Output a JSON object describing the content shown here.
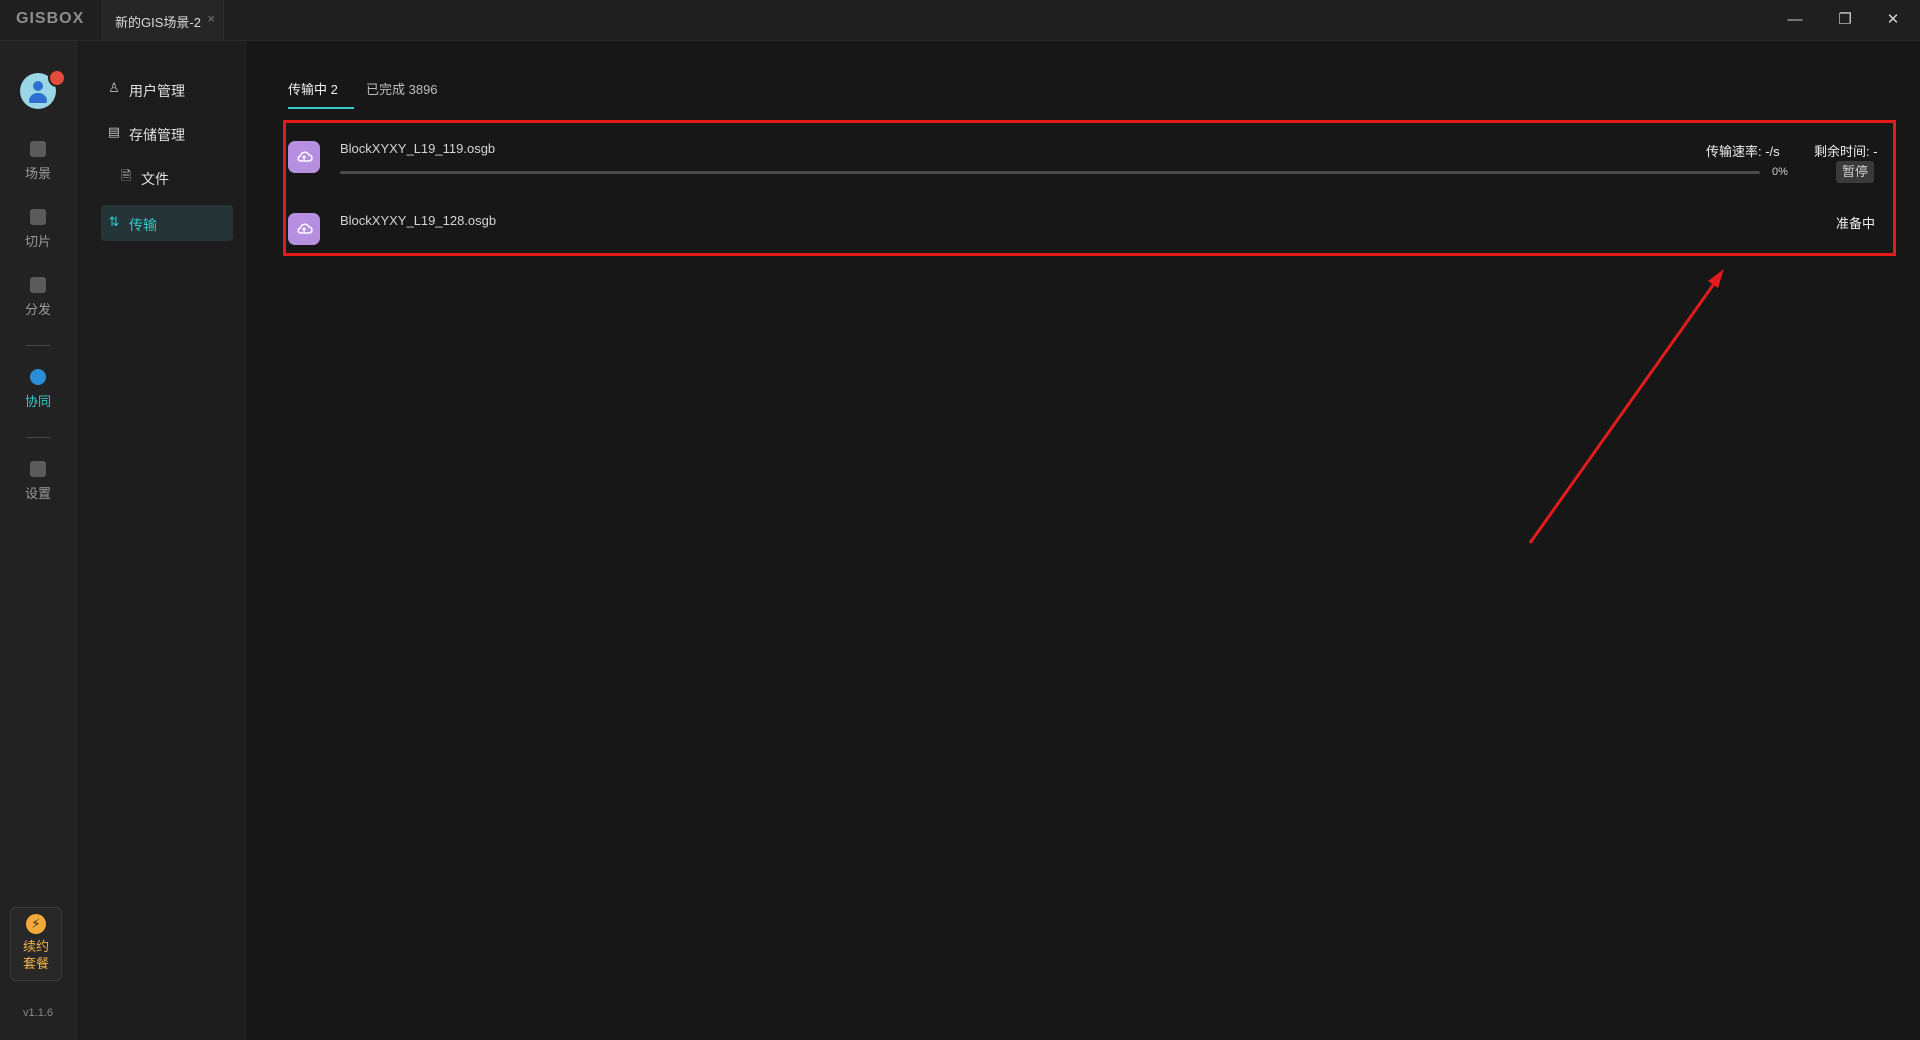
{
  "app": {
    "logo": "GISBOX",
    "tab_title": "新的GIS场景-2",
    "tab_close": "×",
    "window_controls": {
      "minimize": "—",
      "maximize": "❐",
      "close": "✕"
    }
  },
  "rail": {
    "items": [
      {
        "label": "场景",
        "icon": "home-icon"
      },
      {
        "label": "切片",
        "icon": "slice-icon"
      },
      {
        "label": "分发",
        "icon": "distribute-icon"
      },
      {
        "label": "协同",
        "icon": "lock-icon",
        "active": true
      },
      {
        "label": "设置",
        "icon": "gear-icon"
      }
    ],
    "renew": {
      "label": "续约套餐",
      "icon": "lightning-icon",
      "glyph": "⚡"
    },
    "version": "v1.1.6"
  },
  "subnav": {
    "items": [
      {
        "label": "用户管理",
        "icon": "user-icon",
        "glyph": "♙"
      },
      {
        "label": "存储管理",
        "icon": "storage-icon",
        "glyph": "▤"
      },
      {
        "label": "文件",
        "icon": "file-icon",
        "glyph": "🗎"
      },
      {
        "label": "传输",
        "icon": "transfer-icon",
        "glyph": "⇅",
        "active": true
      }
    ]
  },
  "tabs": {
    "transferring": "传输中 2",
    "completed": "已完成 3896"
  },
  "transfers": [
    {
      "name": "BlockXYXY_L19_119.osgb",
      "speed": "传输速率: -/s",
      "remaining": "剩余时间: -",
      "percent": "0%",
      "progress": 0,
      "action": "暂停"
    },
    {
      "name": "BlockXYXY_L19_128.osgb",
      "status": "准备中"
    }
  ],
  "colors": {
    "accent": "#35c8c8",
    "highlight": "#e31b1b",
    "file_icon": "#b68fe0"
  }
}
